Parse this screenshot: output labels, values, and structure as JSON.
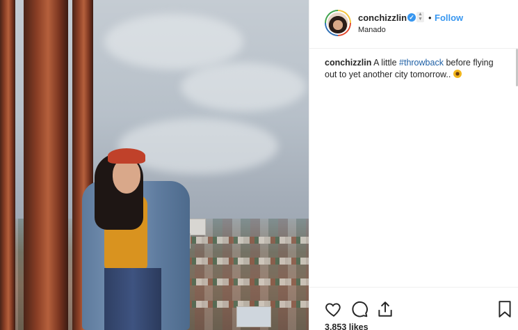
{
  "post": {
    "username": "conchizzlin",
    "verified_badge": "✓",
    "separator": "•",
    "follow_label": "Follow",
    "location": "Manado"
  },
  "caption": {
    "username": "conchizzlin",
    "text_before": "A little",
    "hashtag": "#throwback",
    "text_after": "before flying out to yet another city tomorrow..",
    "emoji": "sunflower-emoji"
  },
  "likes": "3,853 likes",
  "icons": {
    "like": "heart-icon",
    "comment": "comment-icon",
    "share": "share-icon",
    "save": "bookmark-icon"
  },
  "colors": {
    "accent": "#3897f0",
    "text": "#262626",
    "border": "#efefef"
  }
}
